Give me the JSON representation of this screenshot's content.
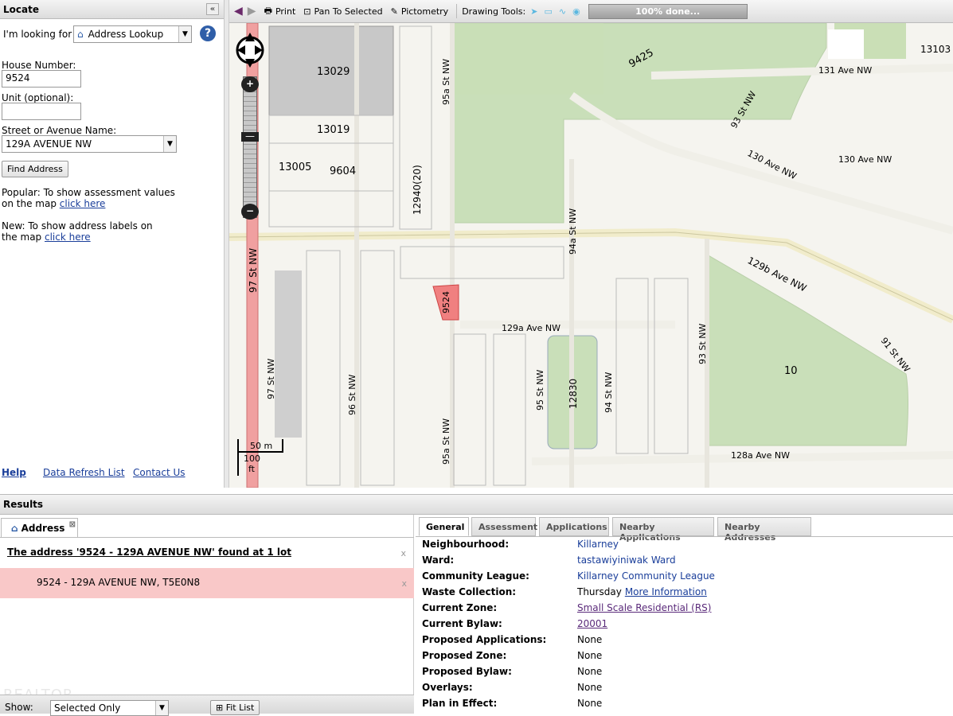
{
  "locate": {
    "title": "Locate",
    "looking_for_label": "I'm looking for",
    "lookup_type": "Address Lookup",
    "house_number_label": "House Number:",
    "house_number_value": "9524",
    "unit_label": "Unit (optional):",
    "unit_value": "",
    "street_label": "Street or Avenue Name:",
    "street_value": "129A AVENUE NW",
    "find_button": "Find Address",
    "popular_text": "Popular: To show assessment values on the map",
    "popular_link": "click here",
    "new_text": "New: To show address labels on the map",
    "new_link": "click here",
    "help_link": "Help",
    "refresh_link": "Data Refresh List",
    "contact_link": "Contact Us"
  },
  "toolbar": {
    "print": "Print",
    "pan": "Pan To Selected",
    "pictometry": "Pictometry",
    "drawing_tools": "Drawing Tools:",
    "progress": "100% done..."
  },
  "map": {
    "scale_m": "50 m",
    "scale_ft_num": "100",
    "scale_ft_unit": "ft",
    "streets": [
      "131 Ave NW",
      "130 Ave NW",
      "130 Ave NW",
      "129b Ave NW",
      "129a Ave NW",
      "128a Ave NW",
      "97 St NW",
      "97 St NW",
      "96 St NW",
      "95a St NW",
      "95a St NW",
      "95 St NW",
      "94a St NW",
      "94 St NW",
      "93 St NW",
      "93 St NW",
      "91 St NW"
    ],
    "lot_labels": [
      "13029",
      "13019",
      "13005",
      "9604",
      "12940(20)",
      "9425",
      "13103",
      "10",
      "12830"
    ],
    "selected_lot": "9524"
  },
  "results": {
    "title": "Results",
    "tab_label": "Address",
    "found_text": "The address '9524 - 129A AVENUE NW' found at 1 lot",
    "result_item": "9524 - 129A AVENUE NW, T5E0N8",
    "show_label": "Show:",
    "show_value": "Selected Only",
    "fit_list": "Fit List",
    "watermark": "REALTOR"
  },
  "detail": {
    "tabs": [
      "General",
      "Assessment",
      "Applications",
      "Nearby Applications",
      "Nearby Addresses"
    ],
    "rows": [
      {
        "k": "Neighbourhood:",
        "v": "Killarney",
        "link": true
      },
      {
        "k": "Ward:",
        "v": "tastawiyiniwak Ward",
        "link": true
      },
      {
        "k": "Community League:",
        "v": "Killarney Community League",
        "link": true
      },
      {
        "k": "Waste Collection:",
        "v": "Thursday",
        "extra": "More Information"
      },
      {
        "k": "Current Zone:",
        "v": "Small Scale Residential (RS)",
        "underline": true
      },
      {
        "k": "Current Bylaw:",
        "v": "20001",
        "underline": true
      },
      {
        "k": "Proposed Applications:",
        "v": "None"
      },
      {
        "k": "Proposed Zone:",
        "v": "None"
      },
      {
        "k": "Proposed Bylaw:",
        "v": "None"
      },
      {
        "k": "Overlays:",
        "v": "None"
      },
      {
        "k": "Plan in Effect:",
        "v": "None"
      }
    ]
  },
  "colors": {
    "accent": "#1a3e9a",
    "selected_row": "#f9c8c8",
    "selected_lot": "#f08080",
    "park": "#c9dfb9",
    "road": "#f1eccb"
  }
}
